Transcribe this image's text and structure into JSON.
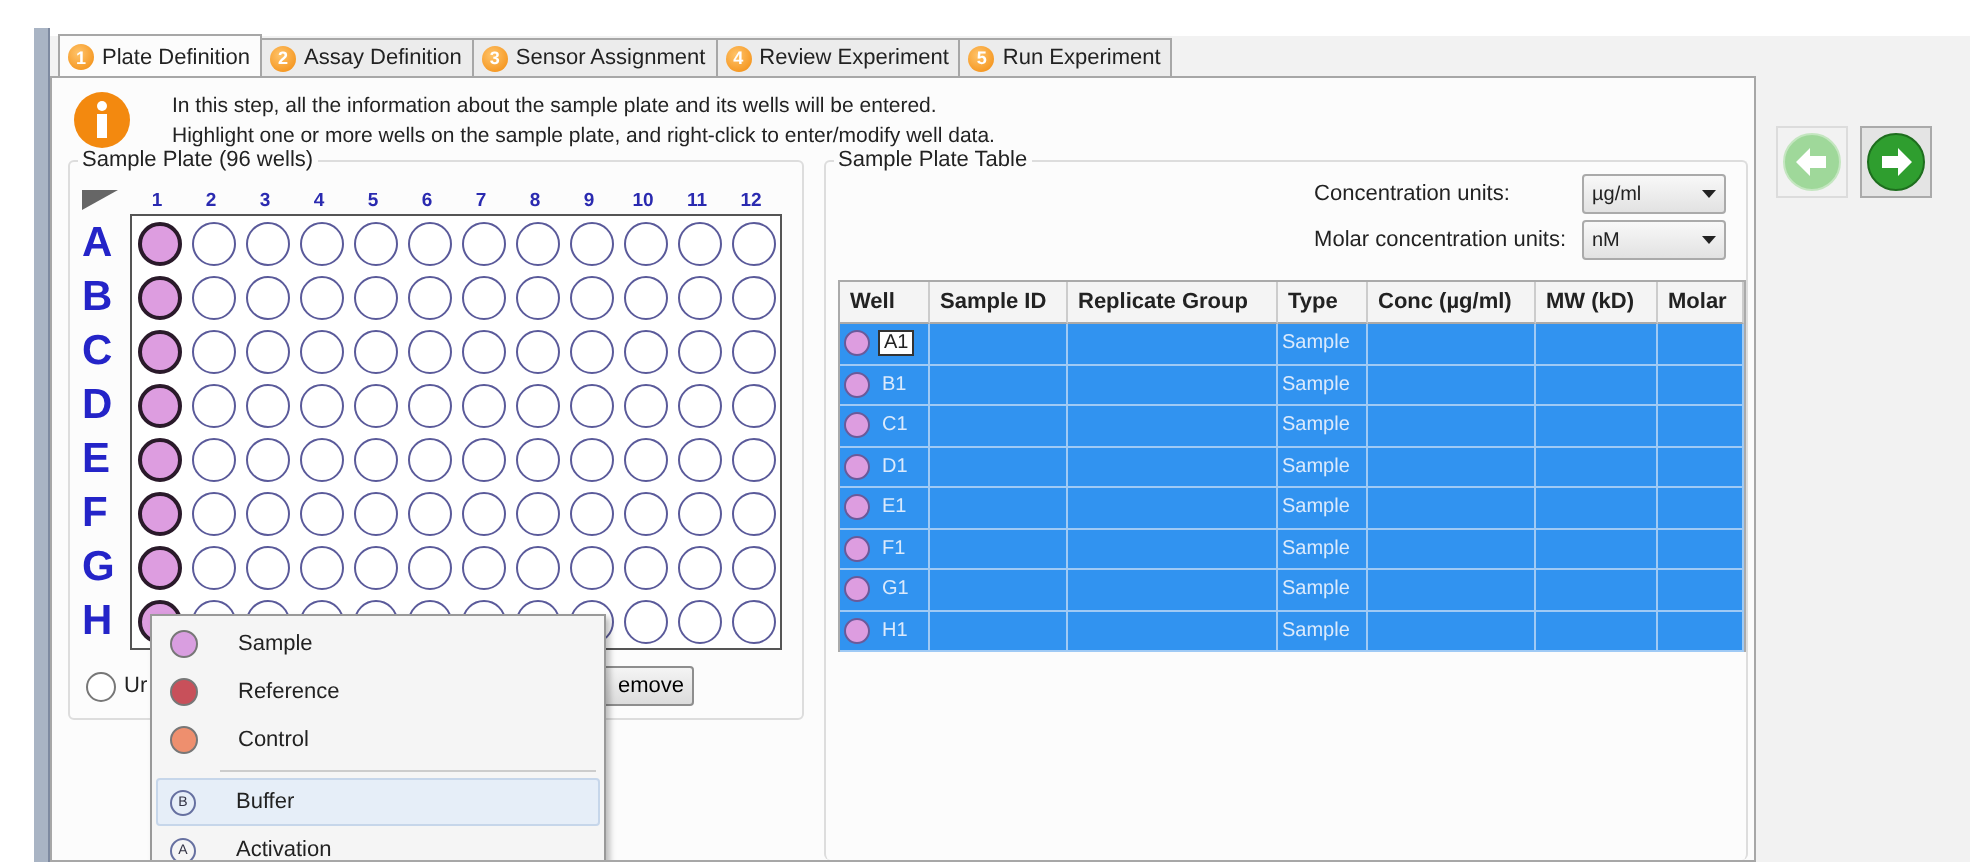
{
  "tabs": [
    {
      "number": "1",
      "label": "Plate Definition",
      "selected": true
    },
    {
      "number": "2",
      "label": "Assay Definition",
      "selected": false
    },
    {
      "number": "3",
      "label": "Sensor Assignment",
      "selected": false
    },
    {
      "number": "4",
      "label": "Review Experiment",
      "selected": false
    },
    {
      "number": "5",
      "label": "Run Experiment",
      "selected": false
    }
  ],
  "info": {
    "lines": [
      "In this step, all the information about the sample plate and its wells will be entered.",
      "Highlight one or more wells on the sample plate, and right-click to enter/modify well data."
    ]
  },
  "nav": [
    {
      "kind": "back",
      "disabled": true
    },
    {
      "kind": "next",
      "disabled": false
    }
  ],
  "plate": {
    "title": "Sample Plate (96 wells)",
    "columns": [
      "1",
      "2",
      "3",
      "4",
      "5",
      "6",
      "7",
      "8",
      "9",
      "10",
      "11",
      "12"
    ],
    "rows": [
      {
        "label": "A",
        "wells": [
          {
            "kind": "sample",
            "selected": true
          },
          {
            "kind": "empty",
            "selected": false
          },
          {
            "kind": "empty",
            "selected": false
          },
          {
            "kind": "empty",
            "selected": false
          },
          {
            "kind": "empty",
            "selected": false
          },
          {
            "kind": "empty",
            "selected": false
          },
          {
            "kind": "empty",
            "selected": false
          },
          {
            "kind": "empty",
            "selected": false
          },
          {
            "kind": "empty",
            "selected": false
          },
          {
            "kind": "empty",
            "selected": false
          },
          {
            "kind": "empty",
            "selected": false
          },
          {
            "kind": "empty",
            "selected": false
          }
        ]
      },
      {
        "label": "B",
        "wells": [
          {
            "kind": "sample",
            "selected": true
          },
          {
            "kind": "empty",
            "selected": false
          },
          {
            "kind": "empty",
            "selected": false
          },
          {
            "kind": "empty",
            "selected": false
          },
          {
            "kind": "empty",
            "selected": false
          },
          {
            "kind": "empty",
            "selected": false
          },
          {
            "kind": "empty",
            "selected": false
          },
          {
            "kind": "empty",
            "selected": false
          },
          {
            "kind": "empty",
            "selected": false
          },
          {
            "kind": "empty",
            "selected": false
          },
          {
            "kind": "empty",
            "selected": false
          },
          {
            "kind": "empty",
            "selected": false
          }
        ]
      },
      {
        "label": "C",
        "wells": [
          {
            "kind": "sample",
            "selected": true
          },
          {
            "kind": "empty",
            "selected": false
          },
          {
            "kind": "empty",
            "selected": false
          },
          {
            "kind": "empty",
            "selected": false
          },
          {
            "kind": "empty",
            "selected": false
          },
          {
            "kind": "empty",
            "selected": false
          },
          {
            "kind": "empty",
            "selected": false
          },
          {
            "kind": "empty",
            "selected": false
          },
          {
            "kind": "empty",
            "selected": false
          },
          {
            "kind": "empty",
            "selected": false
          },
          {
            "kind": "empty",
            "selected": false
          },
          {
            "kind": "empty",
            "selected": false
          }
        ]
      },
      {
        "label": "D",
        "wells": [
          {
            "kind": "sample",
            "selected": true
          },
          {
            "kind": "empty",
            "selected": false
          },
          {
            "kind": "empty",
            "selected": false
          },
          {
            "kind": "empty",
            "selected": false
          },
          {
            "kind": "empty",
            "selected": false
          },
          {
            "kind": "empty",
            "selected": false
          },
          {
            "kind": "empty",
            "selected": false
          },
          {
            "kind": "empty",
            "selected": false
          },
          {
            "kind": "empty",
            "selected": false
          },
          {
            "kind": "empty",
            "selected": false
          },
          {
            "kind": "empty",
            "selected": false
          },
          {
            "kind": "empty",
            "selected": false
          }
        ]
      },
      {
        "label": "E",
        "wells": [
          {
            "kind": "sample",
            "selected": true
          },
          {
            "kind": "empty",
            "selected": false
          },
          {
            "kind": "empty",
            "selected": false
          },
          {
            "kind": "empty",
            "selected": false
          },
          {
            "kind": "empty",
            "selected": false
          },
          {
            "kind": "empty",
            "selected": false
          },
          {
            "kind": "empty",
            "selected": false
          },
          {
            "kind": "empty",
            "selected": false
          },
          {
            "kind": "empty",
            "selected": false
          },
          {
            "kind": "empty",
            "selected": false
          },
          {
            "kind": "empty",
            "selected": false
          },
          {
            "kind": "empty",
            "selected": false
          }
        ]
      },
      {
        "label": "F",
        "wells": [
          {
            "kind": "sample",
            "selected": true
          },
          {
            "kind": "empty",
            "selected": false
          },
          {
            "kind": "empty",
            "selected": false
          },
          {
            "kind": "empty",
            "selected": false
          },
          {
            "kind": "empty",
            "selected": false
          },
          {
            "kind": "empty",
            "selected": false
          },
          {
            "kind": "empty",
            "selected": false
          },
          {
            "kind": "empty",
            "selected": false
          },
          {
            "kind": "empty",
            "selected": false
          },
          {
            "kind": "empty",
            "selected": false
          },
          {
            "kind": "empty",
            "selected": false
          },
          {
            "kind": "empty",
            "selected": false
          }
        ]
      },
      {
        "label": "G",
        "wells": [
          {
            "kind": "sample",
            "selected": true
          },
          {
            "kind": "empty",
            "selected": false
          },
          {
            "kind": "empty",
            "selected": false
          },
          {
            "kind": "empty",
            "selected": false
          },
          {
            "kind": "empty",
            "selected": false
          },
          {
            "kind": "empty",
            "selected": false
          },
          {
            "kind": "empty",
            "selected": false
          },
          {
            "kind": "empty",
            "selected": false
          },
          {
            "kind": "empty",
            "selected": false
          },
          {
            "kind": "empty",
            "selected": false
          },
          {
            "kind": "empty",
            "selected": false
          },
          {
            "kind": "empty",
            "selected": false
          }
        ]
      },
      {
        "label": "H",
        "wells": [
          {
            "kind": "sample",
            "selected": true
          },
          {
            "kind": "empty",
            "selected": false
          },
          {
            "kind": "empty",
            "selected": false
          },
          {
            "kind": "empty",
            "selected": false
          },
          {
            "kind": "empty",
            "selected": false
          },
          {
            "kind": "empty",
            "selected": false
          },
          {
            "kind": "empty",
            "selected": false
          },
          {
            "kind": "empty",
            "selected": false
          },
          {
            "kind": "empty",
            "selected": false
          },
          {
            "kind": "empty",
            "selected": false
          },
          {
            "kind": "empty",
            "selected": false
          },
          {
            "kind": "empty",
            "selected": false
          }
        ]
      }
    ],
    "radio": {
      "label": "Ur",
      "checked": false
    },
    "remove_button": "emove"
  },
  "context_menu": [
    {
      "kind": "color",
      "label": "Sample",
      "color": "#d99ee0",
      "hovered": false
    },
    {
      "kind": "color",
      "label": "Reference",
      "color": "#c8505a",
      "hovered": false
    },
    {
      "kind": "color",
      "label": "Control",
      "color": "#ee8f6e",
      "hovered": false
    },
    {
      "kind": "separator"
    },
    {
      "kind": "letter",
      "letter": "B",
      "label": "Buffer",
      "hovered": true
    },
    {
      "kind": "letter",
      "letter": "A",
      "label": "Activation",
      "hovered": false
    }
  ],
  "table_group": {
    "title": "Sample Plate Table",
    "units": [
      {
        "label": "Concentration units:",
        "value": "µg/ml"
      },
      {
        "label": "Molar concentration units:",
        "value": "nM"
      }
    ],
    "columns": [
      "Well",
      "Sample ID",
      "Replicate Group",
      "Type",
      "Conc (µg/ml)",
      "MW (kD)",
      "Molar"
    ],
    "rows": [
      {
        "well": "A1",
        "type": "Sample",
        "selected": true,
        "focused": true
      },
      {
        "well": "B1",
        "type": "Sample",
        "selected": true,
        "focused": false
      },
      {
        "well": "C1",
        "type": "Sample",
        "selected": true,
        "focused": false
      },
      {
        "well": "D1",
        "type": "Sample",
        "selected": true,
        "focused": false
      },
      {
        "well": "E1",
        "type": "Sample",
        "selected": true,
        "focused": false
      },
      {
        "well": "F1",
        "type": "Sample",
        "selected": true,
        "focused": false
      },
      {
        "well": "G1",
        "type": "Sample",
        "selected": true,
        "focused": false
      },
      {
        "well": "H1",
        "type": "Sample",
        "selected": true,
        "focused": false
      }
    ]
  }
}
